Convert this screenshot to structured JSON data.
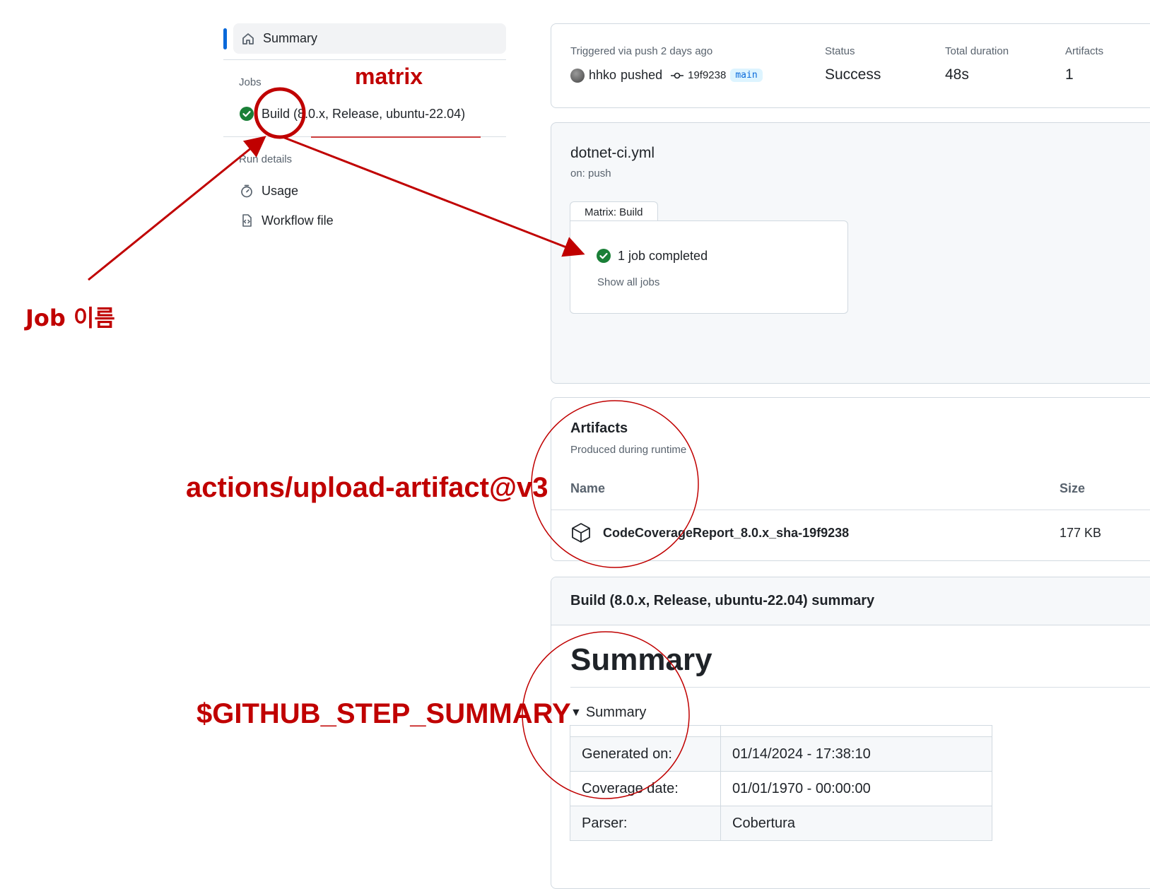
{
  "sidebar": {
    "summary_label": "Summary",
    "jobs_heading": "Jobs",
    "job_label": "Build (8.0.x, Release, ubuntu-22.04)",
    "run_details_heading": "Run details",
    "usage_label": "Usage",
    "workflow_file_label": "Workflow file"
  },
  "run_info": {
    "triggered_label": "Triggered via push 2 days ago",
    "user": "hhko",
    "action": "pushed",
    "commit": "19f9238",
    "branch": "main",
    "status_label": "Status",
    "status_value": "Success",
    "duration_label": "Total duration",
    "duration_value": "48s",
    "artifacts_label": "Artifacts",
    "artifacts_value": "1"
  },
  "workflow": {
    "filename": "dotnet-ci.yml",
    "trigger": "on: push",
    "matrix_tab": "Matrix: Build",
    "jobs_completed": "1 job completed",
    "show_all_jobs": "Show all jobs"
  },
  "artifacts": {
    "title": "Artifacts",
    "subtitle": "Produced during runtime",
    "col_name": "Name",
    "col_size": "Size",
    "items": [
      {
        "name": "CodeCoverageReport_8.0.x_sha-19f9238",
        "size": "177 KB"
      }
    ]
  },
  "job_summary": {
    "header": "Build (8.0.x, Release, ubuntu-22.04) summary",
    "heading": "Summary",
    "details_label": "Summary",
    "rows": [
      {
        "key": "Generated on:",
        "value": "01/14/2024 - 17:38:10"
      },
      {
        "key": "Coverage date:",
        "value": "01/01/1970 - 00:00:00"
      },
      {
        "key": "Parser:",
        "value": "Cobertura"
      }
    ]
  },
  "annotations": {
    "matrix": "matrix",
    "job_name": "Job 이름",
    "upload_artifact": "actions/upload-artifact@v3",
    "step_summary": "$GITHUB_STEP_SUMMARY"
  },
  "colors": {
    "annotation_red": "#c00000",
    "accent_blue": "#0969da",
    "success_green": "#1a7f37"
  }
}
